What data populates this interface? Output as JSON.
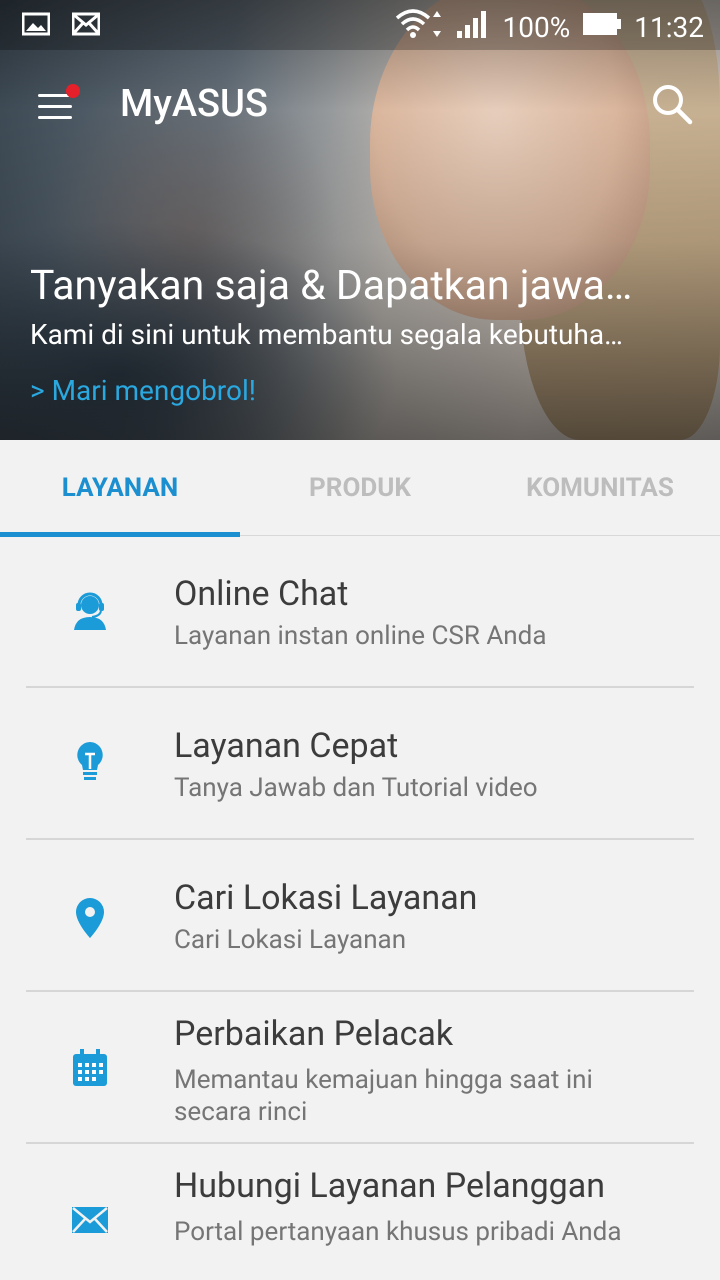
{
  "status_bar": {
    "battery": "100%",
    "time": "11:32",
    "left_icons": [
      "image-icon",
      "mail-icon"
    ],
    "right_icons": [
      "wifi-icon",
      "signal-icon",
      "battery-icon"
    ]
  },
  "toolbar": {
    "app_title": "MyASUS",
    "menu_icon": "hamburger-menu-icon",
    "search_icon": "search-icon"
  },
  "hero": {
    "title": "Tanyakan saja & Dapatkan jawa…",
    "subtitle": "Kami di sini untuk membantu segala kebutuha…",
    "link": "> Mari mengobrol!"
  },
  "tabs": [
    {
      "label": "LAYANAN",
      "active": true
    },
    {
      "label": "PRODUK",
      "active": false
    },
    {
      "label": "KOMUNITAS",
      "active": false
    }
  ],
  "services": [
    {
      "title": "Online Chat",
      "description": "Layanan instan online CSR Anda",
      "icon": "headset-agent-icon"
    },
    {
      "title": "Layanan Cepat",
      "description": "Tanya Jawab dan Tutorial video",
      "icon": "lightbulb-icon"
    },
    {
      "title": "Cari Lokasi Layanan",
      "description": "Cari Lokasi Layanan",
      "icon": "location-pin-icon"
    },
    {
      "title": "Perbaikan Pelacak",
      "description": "Memantau kemajuan hingga saat ini secara rinci",
      "icon": "calendar-icon"
    },
    {
      "title": "Hubungi Layanan Pelanggan",
      "description": "Portal pertanyaan khusus pribadi Anda",
      "icon": "envelope-icon"
    }
  ],
  "colors": {
    "accent": "#1b8fcf",
    "link": "#2aa8e0",
    "notification_dot": "#e5202a"
  }
}
